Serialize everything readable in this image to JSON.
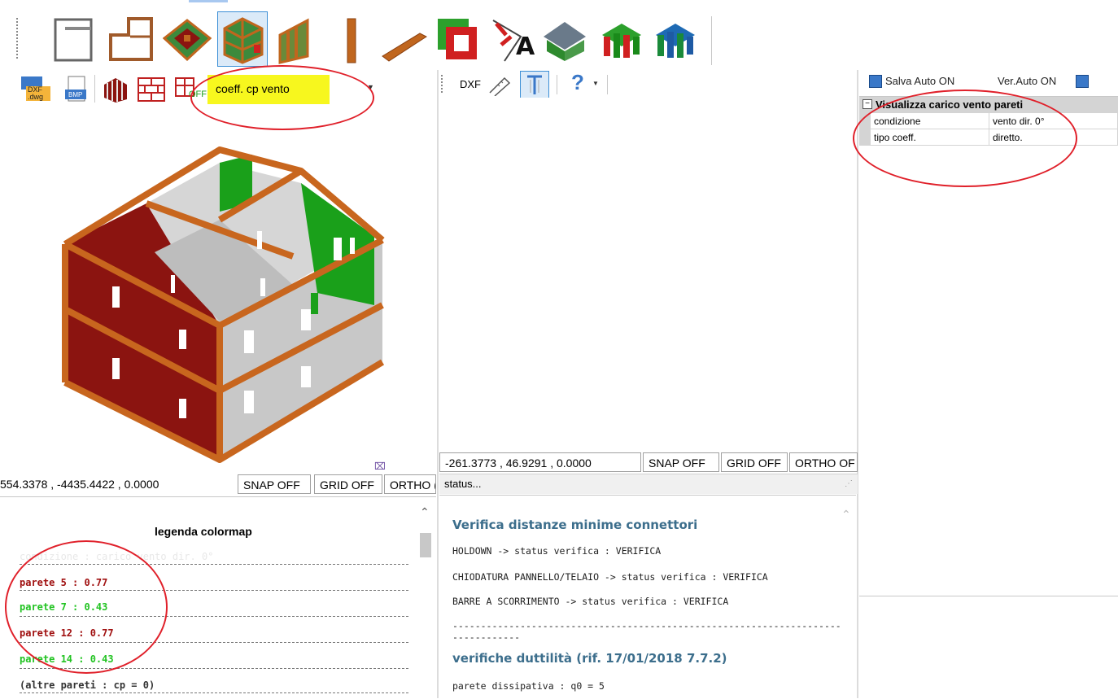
{
  "main_toolbar": {
    "items": [
      "wall-outline-icon",
      "room-outline-icon",
      "floor-panel-3d-icon",
      "frame-3d-icon",
      "wall-studs-icon",
      "post-icon",
      "beam-icon",
      "opening-icon",
      "load-annotation-icon",
      "roof-house-icon",
      "walls-colored-icon",
      "connectors-icon"
    ],
    "selected_index": 3
  },
  "left_toolbar": {
    "dxf_dwg_label": "DXF\n.dwg",
    "bmp_label": "BMP",
    "off_label": "OFF",
    "dropdown_value": "coeff. cp vento"
  },
  "mid_toolbar": {
    "dxf_label": "DXF",
    "help_label": "?"
  },
  "right_toolbar": {
    "salva_label": "Salva Auto ON",
    "ver_label": "Ver.Auto ON"
  },
  "properties": {
    "group_title": "Visualizza carico vento pareti",
    "rows": [
      {
        "key": "condizione",
        "value": "vento dir. 0°"
      },
      {
        "key": "tipo coeff.",
        "value": "diretto."
      }
    ]
  },
  "left_status": {
    "coords": "554.3378 , -4435.4422 , 0.0000",
    "snap": "SNAP OFF",
    "grid": "GRID OFF",
    "ortho": "ORTHO ("
  },
  "mid_status": {
    "coords": "-261.3773 , 46.9291 , 0.0000",
    "snap": "SNAP OFF",
    "grid": "GRID OFF",
    "ortho": "ORTHO OF"
  },
  "status_bar": {
    "text": "status..."
  },
  "legend": {
    "title": "legenda colormap",
    "faded_line": "condizione : carico vento dir. 0°",
    "rows": [
      {
        "label": "parete 5 : 0.77",
        "color": "#a01010"
      },
      {
        "label": "parete 7 : 0.43",
        "color": "#22c322"
      },
      {
        "label": "parete 12 : 0.77",
        "color": "#a01010"
      },
      {
        "label": "parete 14 : 0.43",
        "color": "#22c322"
      }
    ],
    "footer": "(altre pareti : cp = 0)"
  },
  "report": {
    "heading1": "Verifica distanze minime connettori",
    "lines": [
      "HOLDOWN -> status verifica : VERIFICA",
      "CHIODATURA PANNELLO/TELAIO -> status verifica : VERIFICA",
      "BARRE A SCORRIMENTO -> status verifica : VERIFICA"
    ],
    "dashes1": "---------------------------------------------------------------------",
    "dashes2": "------------",
    "heading2": "verifiche duttilità (rif. 17/01/2018 7.7.2)",
    "last_line": "parete dissipativa : q0 = 5"
  },
  "colors": {
    "wall_red": "#8b1410",
    "wall_green": "#1aa01a",
    "wall_grey": "#c8c8c8",
    "timber": "#c8661e",
    "annotation_red": "#e0202a",
    "highlight_yellow": "#f7f71e",
    "report_blue": "#3c6e8c"
  }
}
